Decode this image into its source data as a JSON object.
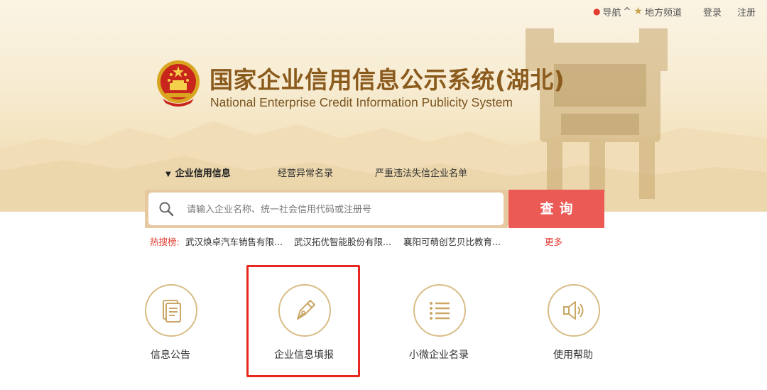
{
  "topbar": {
    "nav_label": "导航",
    "nav_icon": "location-pin-icon",
    "nav_arrow": "^",
    "local_label": "地方频道",
    "local_icon": "star-icon",
    "login_label": "登录",
    "register_label": "注册"
  },
  "header": {
    "title": "国家企业信用信息公示系统(湖北)",
    "subtitle": "National Enterprise Credit Information Publicity System",
    "emblem": "national-emblem"
  },
  "tabs": [
    {
      "label": "企业信用信息",
      "active": true
    },
    {
      "label": "经营异常名录",
      "active": false
    },
    {
      "label": "严重违法失信企业名单",
      "active": false
    }
  ],
  "search": {
    "placeholder": "请输入企业名称、统一社会信用代码或注册号",
    "button_label": "查询"
  },
  "hot_search": {
    "label": "热搜榜:",
    "items": [
      "武汉焕卓汽车销售有限...",
      "武汉拓优智能股份有限...",
      "襄阳可萌创艺贝比教育..."
    ],
    "more_label": "更多"
  },
  "services": [
    {
      "label": "信息公告",
      "icon": "document-icon"
    },
    {
      "label": "企业信息填报",
      "icon": "pen-nib-icon",
      "highlighted": true
    },
    {
      "label": "小微企业名录",
      "icon": "list-icon"
    },
    {
      "label": "使用帮助",
      "icon": "speaker-icon"
    }
  ],
  "colors": {
    "brand_gold": "#8b5b1e",
    "accent_red": "#ec5a55",
    "highlight_red": "#e8281f",
    "icon_gold": "#d8bd86"
  }
}
